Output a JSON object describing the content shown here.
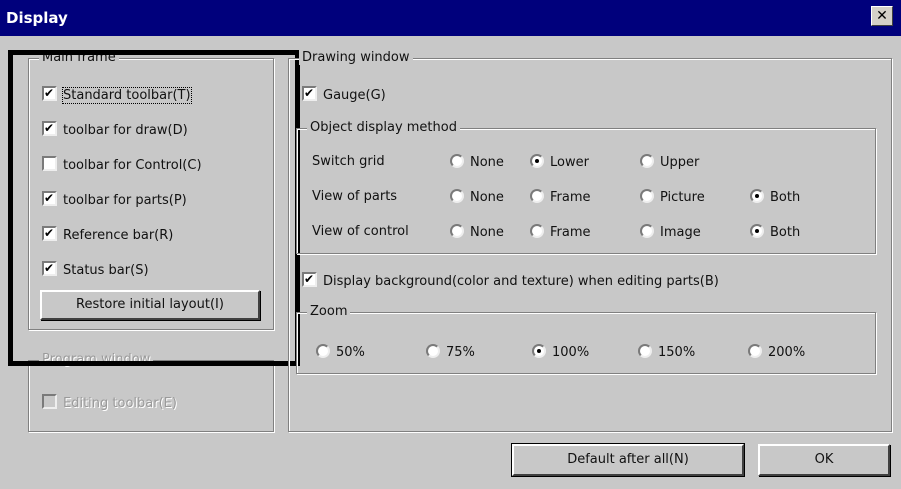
{
  "window": {
    "title": "Display",
    "close_symbol": "✕"
  },
  "main_frame": {
    "legend": "Main frame",
    "items": [
      {
        "label": "Standard toolbar(T)",
        "checked": true
      },
      {
        "label": "toolbar for draw(D)",
        "checked": true
      },
      {
        "label": "toolbar for Control(C)",
        "checked": false
      },
      {
        "label": "toolbar for parts(P)",
        "checked": true
      },
      {
        "label": "Reference bar(R)",
        "checked": true
      },
      {
        "label": "Status bar(S)",
        "checked": true
      }
    ],
    "restore_button": "Restore initial layout(I)"
  },
  "program_window": {
    "legend": "Program window",
    "editing_toolbar": "Editing toolbar(E)"
  },
  "drawing_window": {
    "legend": "Drawing window",
    "gauge": "Gauge(G)",
    "object_display": {
      "legend": "Object display method",
      "rows": [
        {
          "label": "Switch grid",
          "options": [
            "None",
            "Lower",
            "Upper"
          ],
          "selected": "Lower"
        },
        {
          "label": "View of parts",
          "options": [
            "None",
            "Frame",
            "Picture",
            "Both"
          ],
          "selected": "Both"
        },
        {
          "label": "View of control",
          "options": [
            "None",
            "Frame",
            "Image",
            "Both"
          ],
          "selected": "Both"
        }
      ]
    },
    "background_option": "Display background(color and texture) when editing parts(B)",
    "zoom": {
      "legend": "Zoom",
      "options": [
        "50%",
        "75%",
        "100%",
        "150%",
        "200%"
      ],
      "selected": "100%"
    }
  },
  "footer": {
    "default_button": "Default after all(N)",
    "ok_button": "OK"
  }
}
